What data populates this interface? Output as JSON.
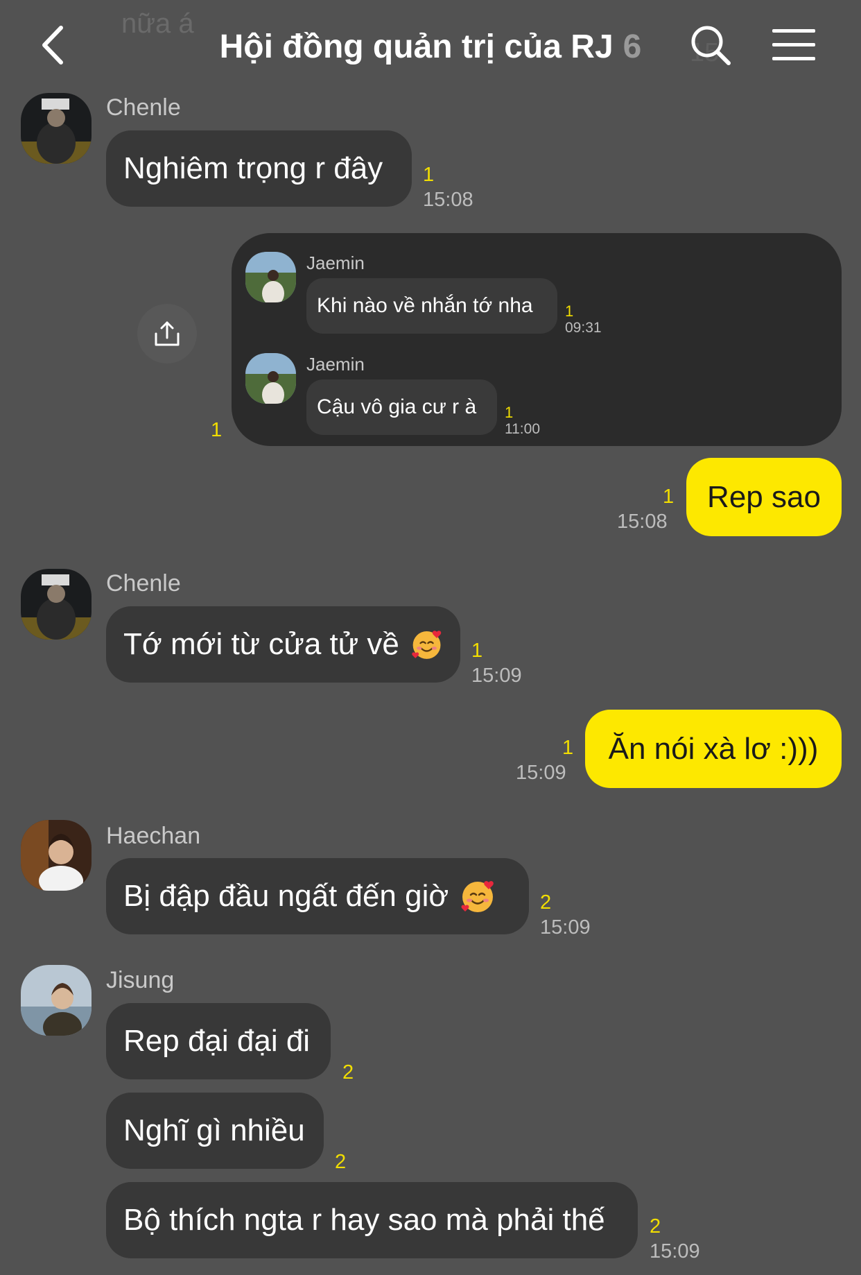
{
  "header": {
    "back_icon": "chevron-left-icon",
    "title": "Hội đồng quản trị của RJ",
    "member_count": "6",
    "search_icon": "search-icon",
    "menu_icon": "hamburger-menu-icon",
    "ghost_text_top": "nữa á",
    "ghost_text_right": "15"
  },
  "messages": {
    "m1": {
      "sender": "Chenle",
      "text": "Nghiêm trọng r đây",
      "unread": "1",
      "time": "15:08"
    },
    "forward": {
      "share_icon": "share-icon",
      "unread": "1",
      "items": [
        {
          "sender": "Jaemin",
          "text": "Khi nào về nhắn tớ nha",
          "unread": "1",
          "time": "09:31"
        },
        {
          "sender": "Jaemin",
          "text": "Cậu vô gia cư r à",
          "unread": "1",
          "time": "11:00"
        }
      ]
    },
    "m2": {
      "text": "Rep sao",
      "unread": "1",
      "time": "15:08"
    },
    "m3": {
      "sender": "Chenle",
      "text": "Tớ mới từ cửa tử về",
      "emoji": "smiling-face-with-hearts-icon",
      "unread": "1",
      "time": "15:09"
    },
    "m4": {
      "text": "Ăn nói xà lơ :)))",
      "unread": "1",
      "time": "15:09"
    },
    "m5": {
      "sender": "Haechan",
      "text": "Bị đập đầu ngất đến giờ",
      "emoji": "smiling-face-with-hearts-icon",
      "unread": "2",
      "time": "15:09"
    },
    "m6": {
      "sender": "Jisung",
      "text": "Rep đại đại đi",
      "unread": "2"
    },
    "m7": {
      "text": "Nghĩ gì nhiều",
      "unread": "2"
    },
    "m8": {
      "text": "Bộ thích ngta r hay sao mà phải thế",
      "unread": "2",
      "time": "15:09"
    }
  },
  "colors": {
    "background": "#525252",
    "bubble_other": "#383838",
    "bubble_me": "#fde800",
    "unread": "#f2de00",
    "forward_card": "#2b2b2b"
  }
}
